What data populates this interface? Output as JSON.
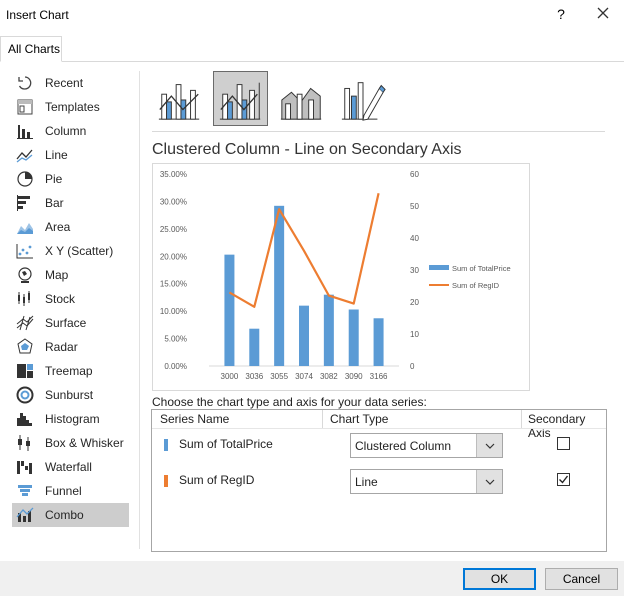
{
  "window": {
    "title": "Insert Chart",
    "help_label": "?"
  },
  "tabs": [
    {
      "label": "All Charts"
    }
  ],
  "categories": [
    {
      "label": "Recent",
      "icon": "recent-icon"
    },
    {
      "label": "Templates",
      "icon": "templates-icon"
    },
    {
      "label": "Column",
      "icon": "column-chart-icon"
    },
    {
      "label": "Line",
      "icon": "line-chart-icon"
    },
    {
      "label": "Pie",
      "icon": "pie-chart-icon"
    },
    {
      "label": "Bar",
      "icon": "bar-chart-icon"
    },
    {
      "label": "Area",
      "icon": "area-chart-icon"
    },
    {
      "label": "X Y (Scatter)",
      "icon": "scatter-chart-icon"
    },
    {
      "label": "Map",
      "icon": "map-chart-icon"
    },
    {
      "label": "Stock",
      "icon": "stock-chart-icon"
    },
    {
      "label": "Surface",
      "icon": "surface-chart-icon"
    },
    {
      "label": "Radar",
      "icon": "radar-chart-icon"
    },
    {
      "label": "Treemap",
      "icon": "treemap-chart-icon"
    },
    {
      "label": "Sunburst",
      "icon": "sunburst-chart-icon"
    },
    {
      "label": "Histogram",
      "icon": "histogram-chart-icon"
    },
    {
      "label": "Box & Whisker",
      "icon": "box-whisker-chart-icon"
    },
    {
      "label": "Waterfall",
      "icon": "waterfall-chart-icon"
    },
    {
      "label": "Funnel",
      "icon": "funnel-chart-icon"
    },
    {
      "label": "Combo",
      "icon": "combo-chart-icon"
    }
  ],
  "selected_category": "Combo",
  "subtypes": [
    {
      "icon": "clustered-column-line-icon"
    },
    {
      "icon": "clustered-column-line-secondary-axis-icon"
    },
    {
      "icon": "stacked-area-clustered-column-icon"
    },
    {
      "icon": "custom-combination-icon"
    }
  ],
  "selected_subtype_index": 1,
  "preview_title": "Clustered Column - Line on Secondary Axis",
  "chart_data": {
    "type": "bar",
    "categories": [
      "3000",
      "3036",
      "3055",
      "3074",
      "3082",
      "3090",
      "3166"
    ],
    "series": [
      {
        "name": "Sum of TotalPrice",
        "type": "bar",
        "axis": "primary",
        "color": "#5b9bd5",
        "values": [
          0.203,
          0.068,
          0.292,
          0.11,
          0.13,
          0.103,
          0.087
        ]
      },
      {
        "name": "Sum of RegID",
        "type": "line",
        "axis": "secondary",
        "color": "#ed7d31",
        "values": [
          23,
          18.5,
          49,
          36,
          22,
          19.5,
          54
        ]
      }
    ],
    "y_ticks": [
      "0.00%",
      "5.00%",
      "10.00%",
      "15.00%",
      "20.00%",
      "25.00%",
      "30.00%",
      "35.00%"
    ],
    "y2_ticks": [
      "0",
      "10",
      "20",
      "30",
      "40",
      "50",
      "60"
    ],
    "ylim": [
      0,
      0.35
    ],
    "y2lim": [
      0,
      60
    ],
    "legend_position": "right",
    "grid": false
  },
  "series_section": {
    "prompt": "Choose the chart type and axis for your data series:",
    "headers": {
      "series_name": "Series Name",
      "chart_type": "Chart Type",
      "secondary_axis": "Secondary Axis"
    },
    "rows": [
      {
        "name": "Sum of TotalPrice",
        "color": "#5b9bd5",
        "chart_type": "Clustered Column",
        "secondary": false
      },
      {
        "name": "Sum of RegID",
        "color": "#ed7d31",
        "chart_type": "Line",
        "secondary": true
      }
    ]
  },
  "footer": {
    "ok_label": "OK",
    "cancel_label": "Cancel"
  }
}
